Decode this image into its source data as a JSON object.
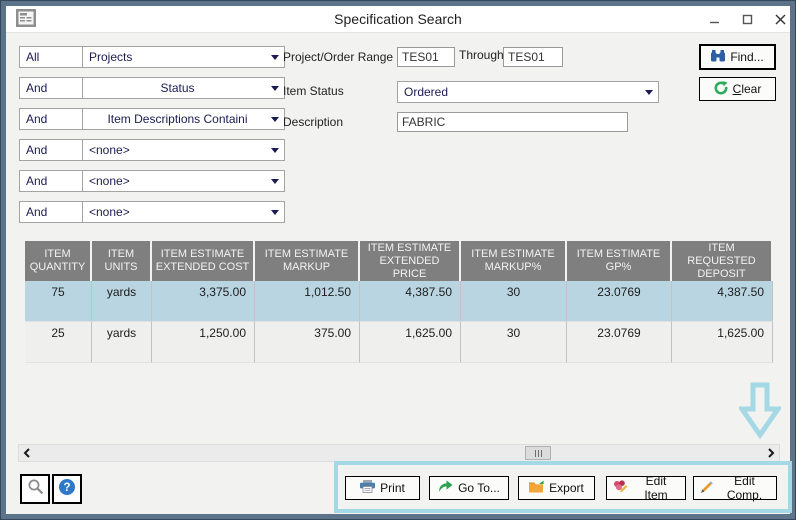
{
  "window": {
    "title": "Specification Search"
  },
  "filters": [
    {
      "op": "All",
      "field": "Projects"
    },
    {
      "op": "And",
      "field": "Status"
    },
    {
      "op": "And",
      "field": "Item Descriptions Containi"
    },
    {
      "op": "And",
      "field": "<none>"
    },
    {
      "op": "And",
      "field": "<none>"
    },
    {
      "op": "And",
      "field": "<none>"
    }
  ],
  "criteria": {
    "project_range_label": "Project/Order Range",
    "project_from": "TES01",
    "through_label": "Through",
    "project_to": "TES01",
    "item_status_label": "Item Status",
    "item_status": "Ordered",
    "description_label": "Description",
    "description": "FABRIC"
  },
  "actions": {
    "find": "Find...",
    "clear_initial": "C",
    "clear_rest": "lear"
  },
  "table": {
    "columns": [
      "ITEM QUANTITY",
      "ITEM UNITS",
      "ITEM ESTIMATE EXTENDED COST",
      "ITEM ESTIMATE MARKUP",
      "ITEM ESTIMATE EXTENDED PRICE",
      "ITEM ESTIMATE MARKUP%",
      "ITEM ESTIMATE GP%",
      "ITEM REQUESTED DEPOSIT"
    ],
    "rows": [
      {
        "selected": true,
        "cells": [
          "75",
          "yards",
          "3,375.00",
          "1,012.50",
          "4,387.50",
          "30",
          "23.0769",
          "4,387.50"
        ]
      },
      {
        "selected": false,
        "cells": [
          "25",
          "yards",
          "1,250.00",
          "375.00",
          "1,625.00",
          "30",
          "23.0769",
          "1,625.00"
        ]
      }
    ]
  },
  "footer": {
    "print": "Print",
    "go_to": "Go To...",
    "export": "Export",
    "edit_item": "Edit Item",
    "edit_comp": "Edit Comp.",
    "help_glyph": "?"
  },
  "icons": [
    "form-icon",
    "minimize-icon",
    "maximize-icon",
    "close-icon",
    "dropdown-arrow-icon",
    "binoculars-icon",
    "clear-refresh-icon",
    "printer-icon",
    "goto-arrow-icon",
    "export-folder-icon",
    "edit-item-icon",
    "pencil-icon",
    "magnifier-icon",
    "help-icon",
    "scroll-left-icon",
    "scroll-right-icon",
    "callout-down-arrow-icon"
  ],
  "colors": {
    "highlight": "#A5D8E5",
    "header_bg": "#7F7F7F",
    "selected_row": "#B9D5E1",
    "frame": "#5D7389"
  }
}
